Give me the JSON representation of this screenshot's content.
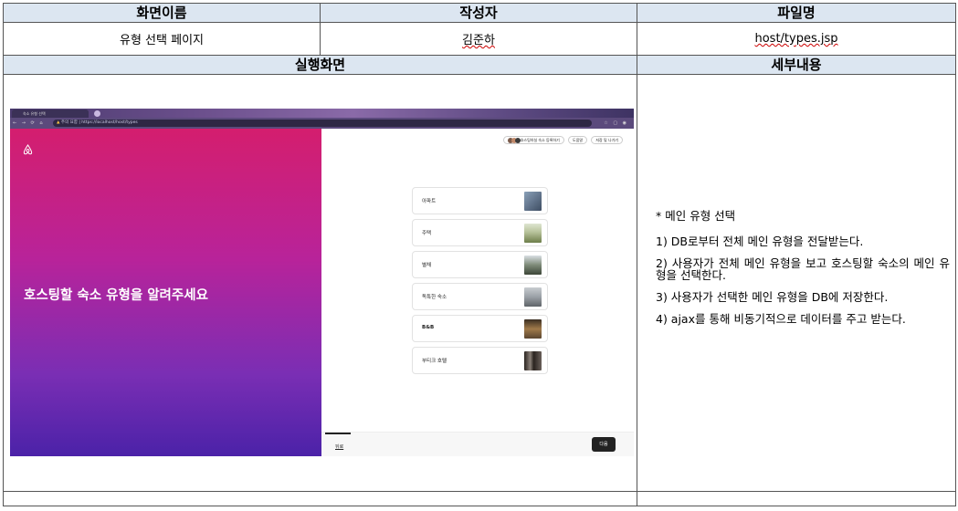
{
  "table": {
    "header1": {
      "screen_name": "화면이름",
      "author": "작성자",
      "file_name": "파일명"
    },
    "row1": {
      "screen_name": "유형 선택 페이지",
      "author": "김준하",
      "file_name": "host/types.jsp"
    },
    "header2": {
      "run_screen": "실행화면",
      "details": "세부내용"
    }
  },
  "screenshot": {
    "browser": {
      "tab_title": "숙소 유형 선택",
      "warning_label": "주의 요함",
      "url": "https://localhost/host/types",
      "window_buttons": [
        "–",
        "□",
        "✕"
      ]
    },
    "left_title": "호스팅할 숙소 유형을 알려주세요",
    "top_actions": {
      "guide_label": "호스팅하실 숙소 등록하기",
      "question_label": "도움말",
      "save_exit_label": "저장 및 나가기"
    },
    "options": [
      {
        "label": "아파트",
        "icon": "apartment-photo",
        "color": "#5a6b82"
      },
      {
        "label": "주택",
        "icon": "house-photo",
        "color": "#8a9a6a"
      },
      {
        "label": "별채",
        "icon": "annex-photo",
        "color": "#4d5a48"
      },
      {
        "label": "독특한 숙소",
        "icon": "unique-stay-photo",
        "color": "#8a9098"
      },
      {
        "label": "B&B",
        "icon": "bnb-photo",
        "color": "#6e5a3e"
      },
      {
        "label": "부티크 호텔",
        "icon": "boutique-hotel-photo",
        "color": "#4a4440"
      }
    ],
    "footer": {
      "back_label": "뒤로",
      "next_label": "다음"
    },
    "colors": {
      "gradient_top": "#d41e6e",
      "gradient_bottom": "#4b22a8"
    }
  },
  "details": {
    "title": "* 메인 유형 선택",
    "items": [
      "1) DB로부터 전체 메인 유형을 전달받는다.",
      "2) 사용자가 전체 메인 유형을 보고 호스팅할 숙소의 메인 유형을 선택한다.",
      "3) 사용자가 선택한 메인 유형을 DB에 저장한다.",
      "4) ajax를 통해 비동기적으로 데이터를 주고 받는다."
    ]
  }
}
